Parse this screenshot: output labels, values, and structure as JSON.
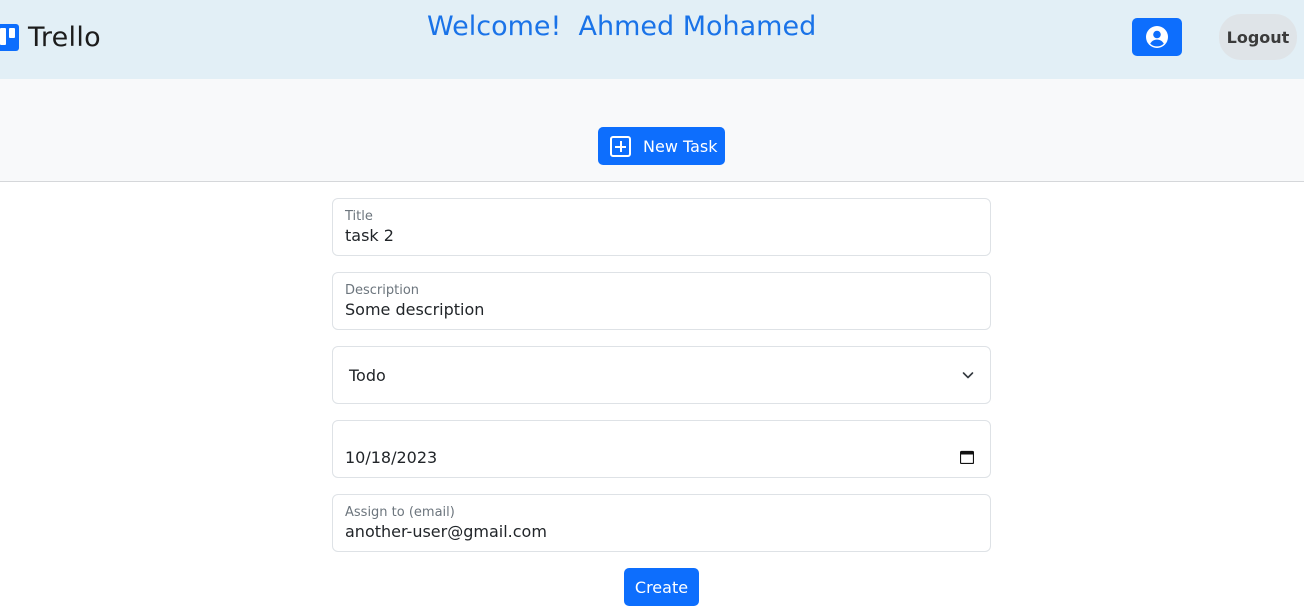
{
  "header": {
    "logo_text": "Trello",
    "welcome": "Welcome!  Ahmed Mohamed",
    "logout_label": "Logout",
    "profile_icon": "user-circle-icon"
  },
  "toolbar": {
    "new_task_label": "New Task",
    "new_task_icon": "plus-square-icon"
  },
  "form": {
    "title": {
      "label": "Title",
      "value": "task 2"
    },
    "description": {
      "label": "Description",
      "value": "Some description"
    },
    "status": {
      "selected": "Todo"
    },
    "due_date": {
      "value": "10/18/2023"
    },
    "assignee": {
      "label": "Assign to (email)",
      "value": "another-user@gmail.com"
    },
    "submit_label": "Create"
  },
  "colors": {
    "primary": "#0d6efd",
    "header_bg": "#e2eff6",
    "welcome_text": "#1a73e8"
  }
}
